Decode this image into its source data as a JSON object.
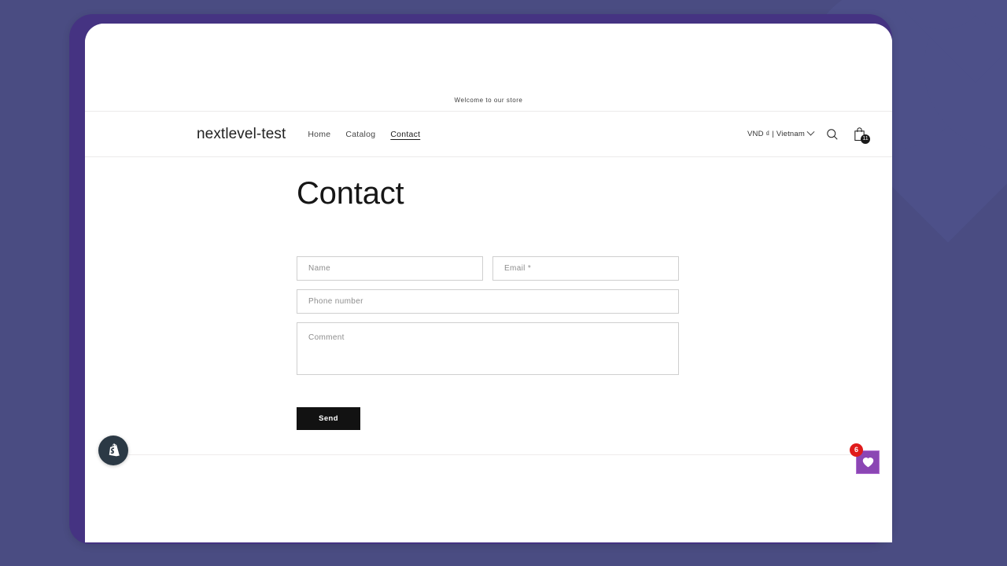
{
  "theme": {
    "desktop_bg": "#4a4c82",
    "frame_purple": "#453382",
    "accent_dark": "#121212",
    "widget_purple": "#8b46b4",
    "badge_red": "#e01b1b"
  },
  "announcement": {
    "text": "Welcome to our store"
  },
  "header": {
    "brand": "nextlevel-test",
    "nav": [
      {
        "label": "Home",
        "active": false
      },
      {
        "label": "Catalog",
        "active": false
      },
      {
        "label": "Contact",
        "active": true
      }
    ],
    "locale": {
      "label": "VND ₫ | Vietnam",
      "chevron_icon": "chevron-down-icon"
    },
    "search_icon": "search-icon",
    "cart_icon": "shopping-bag-icon",
    "cart_count": "11"
  },
  "main": {
    "page_title": "Contact"
  },
  "form": {
    "name": {
      "placeholder": "Name",
      "value": ""
    },
    "email": {
      "placeholder": "Email *",
      "value": ""
    },
    "phone": {
      "placeholder": "Phone number",
      "value": ""
    },
    "comment": {
      "placeholder": "Comment",
      "value": ""
    },
    "submit_label": "Send"
  },
  "widgets": {
    "shopify_bubble": {
      "icon": "shopify-bag-icon"
    },
    "heart_widget": {
      "icon": "heart-icon",
      "badge_count": "6"
    }
  }
}
